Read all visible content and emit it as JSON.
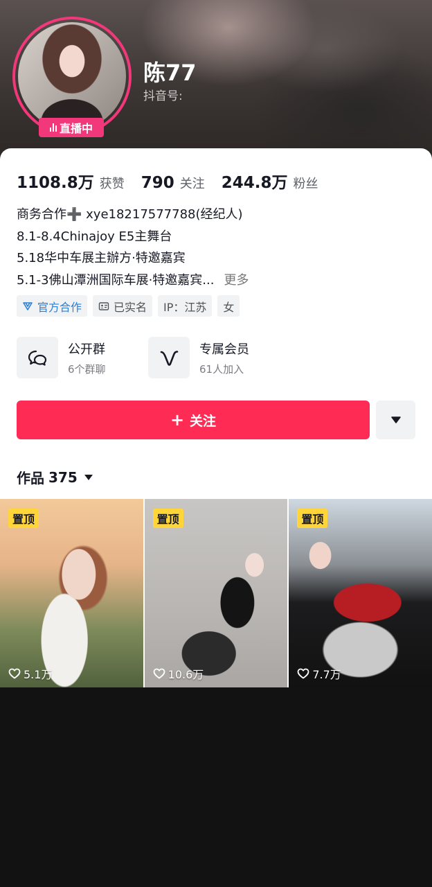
{
  "profile": {
    "name": "陈77",
    "douyin_id_label": "抖音号:",
    "live_badge": "直播中"
  },
  "stats": [
    {
      "value": "1108.8万",
      "label": "获赞"
    },
    {
      "value": "790",
      "label": "关注"
    },
    {
      "value": "244.8万",
      "label": "粉丝"
    }
  ],
  "bio": {
    "line1": "商务合作➕ xye18217577788(经纪人)",
    "line2": "8.1-8.4Chinajoy E5主舞台",
    "line3": "5.18华中车展主辦方·特邀嘉宾",
    "line4": "5.1-3佛山潭洲国际车展·特邀嘉宾...",
    "more": "更多"
  },
  "tags": {
    "official": "官方合作",
    "verified": "已实名",
    "ip": "IP：江苏",
    "gender": "女"
  },
  "features": {
    "group": {
      "title": "公开群",
      "sub": "6个群聊"
    },
    "member": {
      "title": "专属会员",
      "sub": "61人加入"
    }
  },
  "follow_button": "关注",
  "works": {
    "label": "作品",
    "count": "375"
  },
  "thumbnails": [
    {
      "badge": "置顶",
      "likes": "5.1万"
    },
    {
      "badge": "置顶",
      "likes": "10.6万"
    },
    {
      "badge": "置顶",
      "likes": "7.7万"
    }
  ],
  "colors": {
    "accent": "#fe2c55",
    "live": "#f2387a",
    "pin": "#ffd53a",
    "official": "#2b7fd9"
  }
}
